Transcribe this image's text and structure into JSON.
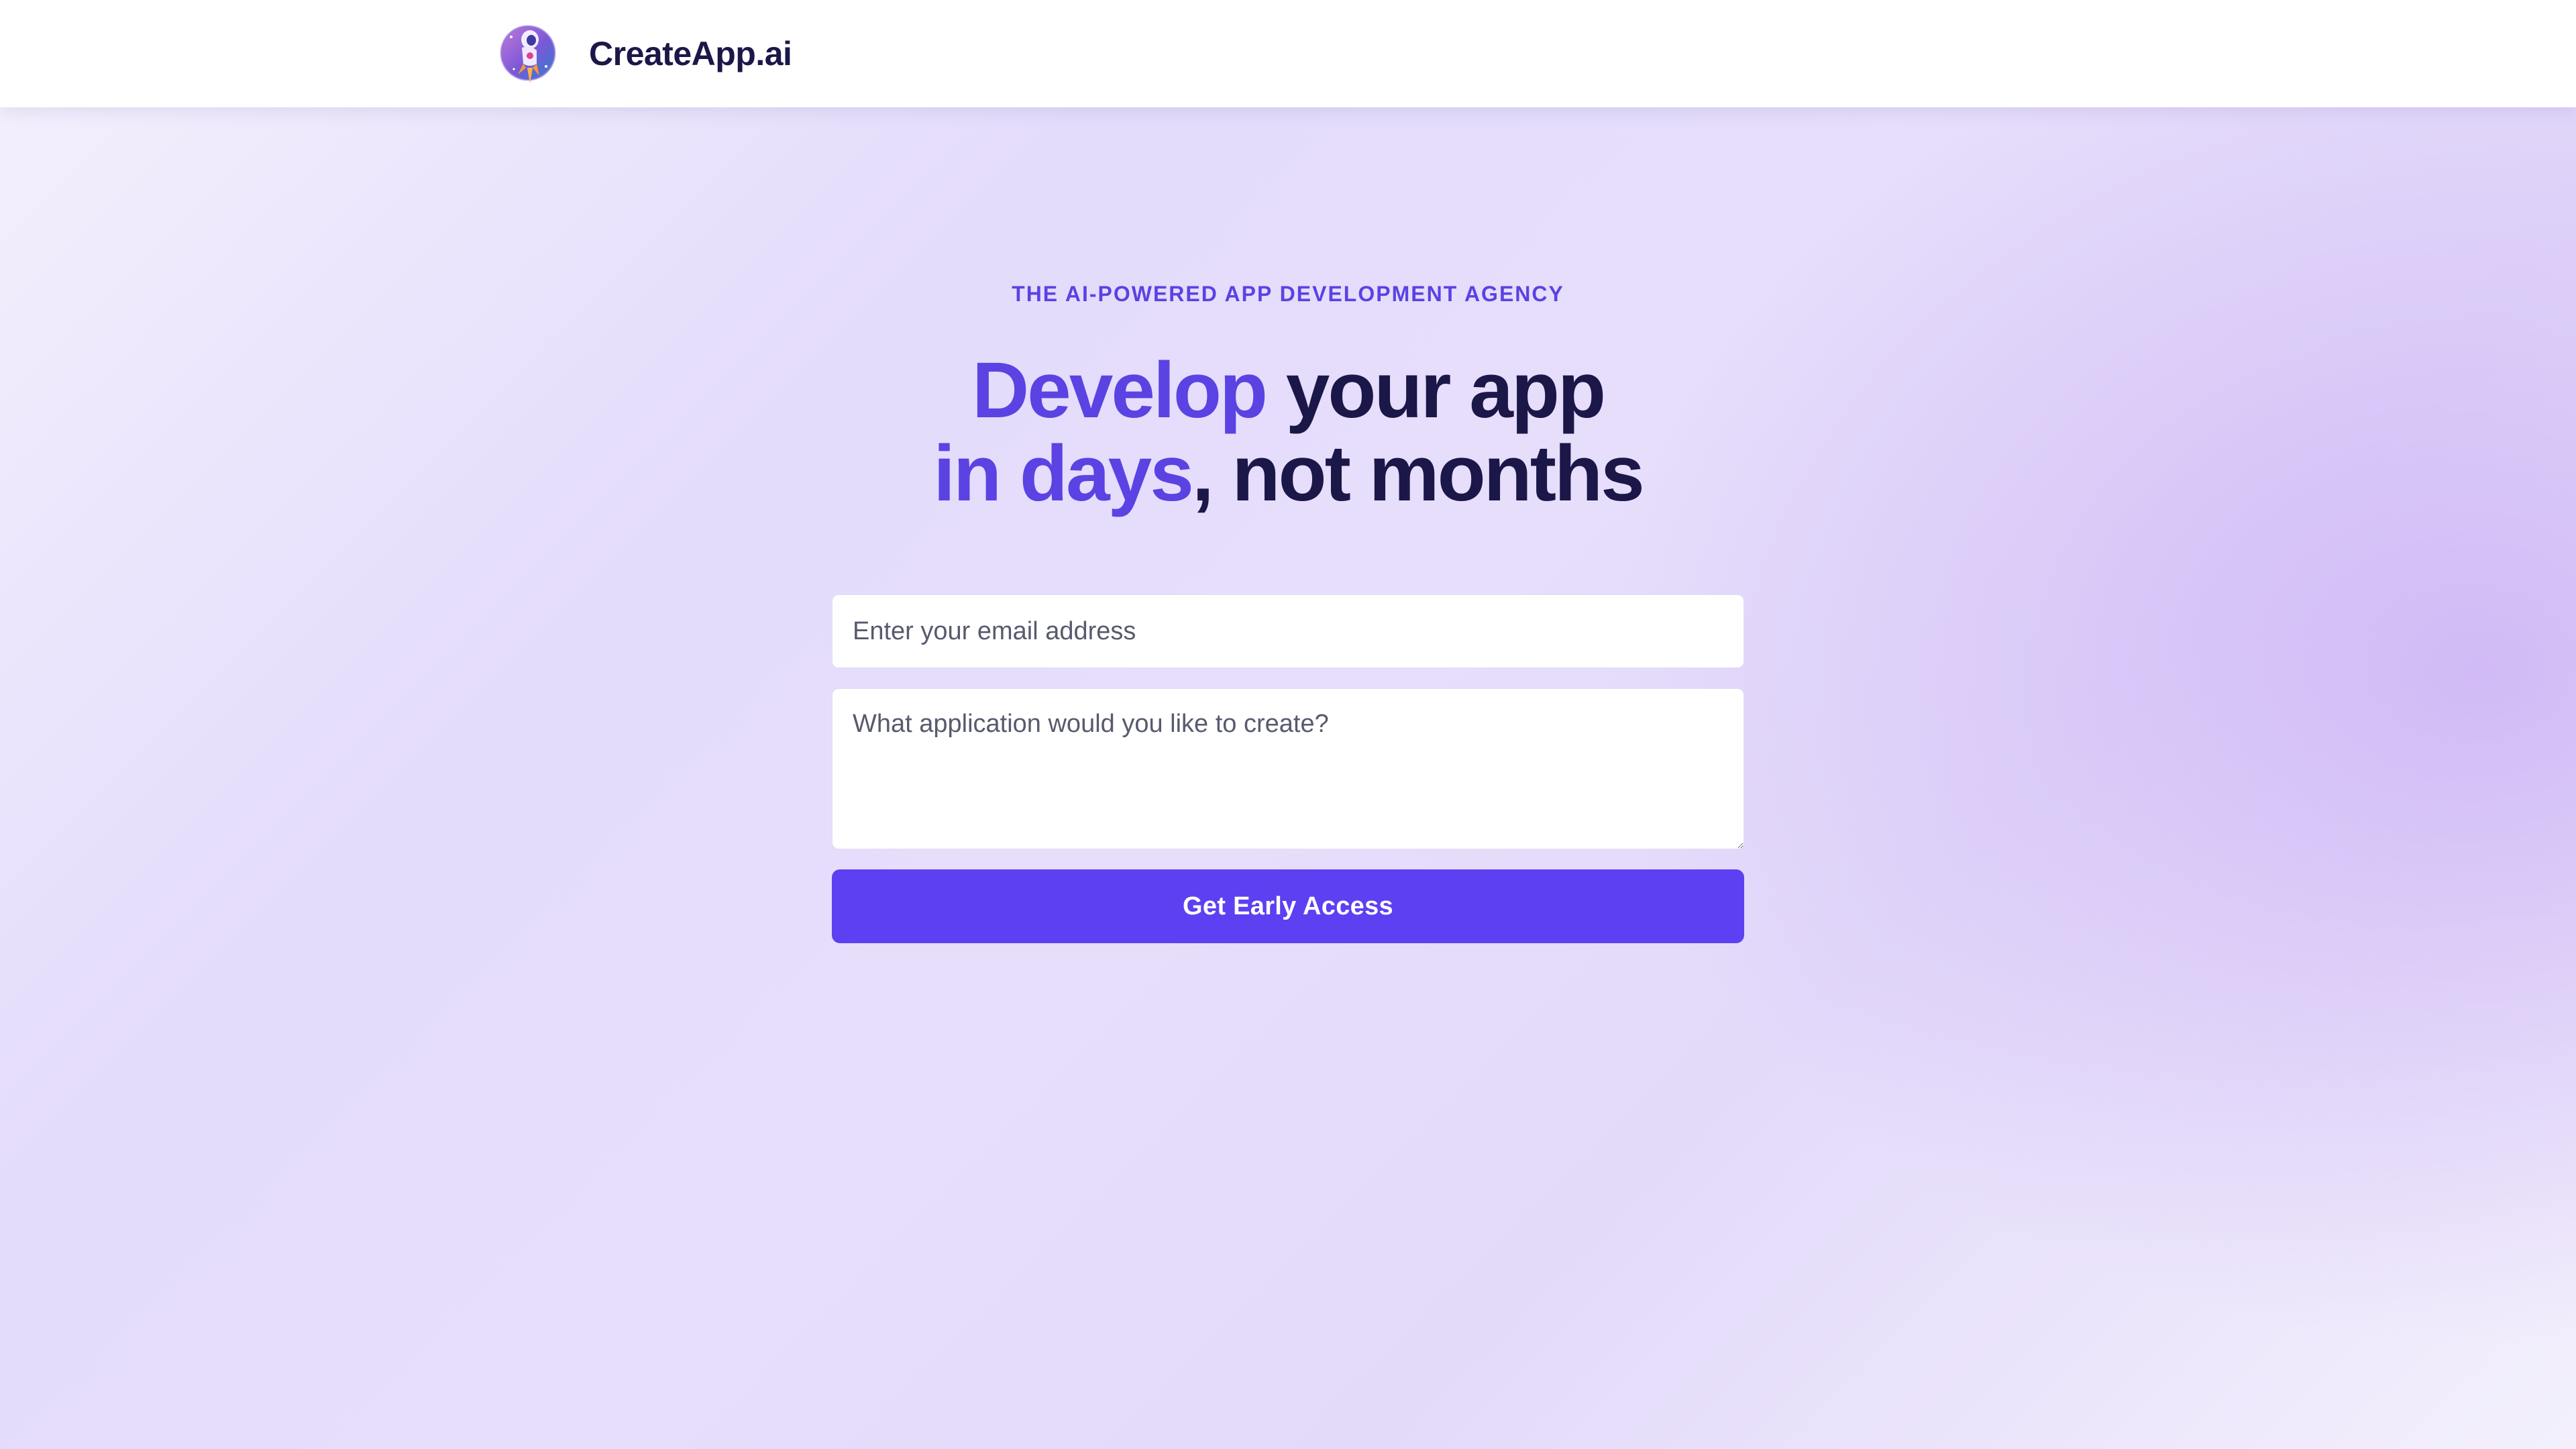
{
  "header": {
    "logo_icon": "rocket-astronaut-logo-icon",
    "brand_name": "CreateApp.ai"
  },
  "hero": {
    "eyebrow": "THE AI-POWERED APP DEVELOPMENT AGENCY",
    "headline_line1_accent": "Develop",
    "headline_line1_rest": " your app",
    "headline_line2_accent": "in days",
    "headline_line2_rest": ", not months"
  },
  "form": {
    "email_placeholder": "Enter your email address",
    "email_value": "",
    "message_placeholder": "What application would you like to create?",
    "message_value": "",
    "submit_label": "Get Early Access"
  },
  "colors": {
    "accent": "#5b42e3",
    "button": "#5d40f1",
    "heading": "#1b1748",
    "background": "#e6defb"
  }
}
